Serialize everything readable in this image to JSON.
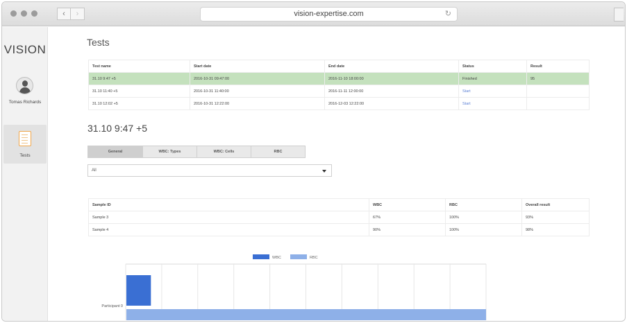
{
  "browser": {
    "url": "vision-expertise.com",
    "back_glyph": "‹",
    "forward_glyph": "›",
    "reload_glyph": "↻"
  },
  "sidebar": {
    "logo": "VISION",
    "user_name": "Tomas Richards",
    "nav_tests_label": "Tests"
  },
  "page": {
    "title": "Tests"
  },
  "tests_table": {
    "headers": [
      "Test name",
      "Start date",
      "End date",
      "Status",
      "Result"
    ],
    "rows": [
      {
        "name": "31.10 9:47 +5",
        "start": "2016-10-31 09:47:00",
        "end": "2016-11-10 18:00:00",
        "status": "Finished",
        "result": "95"
      },
      {
        "name": "31.10 11:40 +5",
        "start": "2016-10-31 11:40:00",
        "end": "2016-11-11 12:00:00",
        "status": "Start",
        "result": ""
      },
      {
        "name": "31.10 12:02 +5",
        "start": "2016-10-31 12:22:00",
        "end": "2016-12-03 12:22:00",
        "status": "Start",
        "result": ""
      }
    ]
  },
  "detail": {
    "title": "31.10 9:47 +5",
    "tabs": [
      "General",
      "WBC: Types",
      "WBC: Cells",
      "RBC"
    ],
    "select_value": "All"
  },
  "sample_table": {
    "headers": [
      "Sample ID",
      "WBC",
      "RBC",
      "Overall result"
    ],
    "rows": [
      {
        "id": "Sample 3",
        "wbc": "67%",
        "rbc": "100%",
        "overall": "93%"
      },
      {
        "id": "Sample 4",
        "wbc": "90%",
        "rbc": "100%",
        "overall": "98%"
      }
    ]
  },
  "colors": {
    "wbc": "#3a6fd3",
    "rbc": "#8eb0e8",
    "selected_row": "#c4e1bd",
    "link": "#5a7fd4"
  },
  "chart_data": {
    "type": "bar",
    "orientation": "horizontal",
    "categories": [
      "Participant 0"
    ],
    "series": [
      {
        "name": "WBC",
        "values": [
          7
        ]
      },
      {
        "name": "RBC",
        "values": [
          100
        ]
      }
    ],
    "legend": "top-center",
    "grid": true,
    "xlim": [
      0,
      100
    ]
  }
}
